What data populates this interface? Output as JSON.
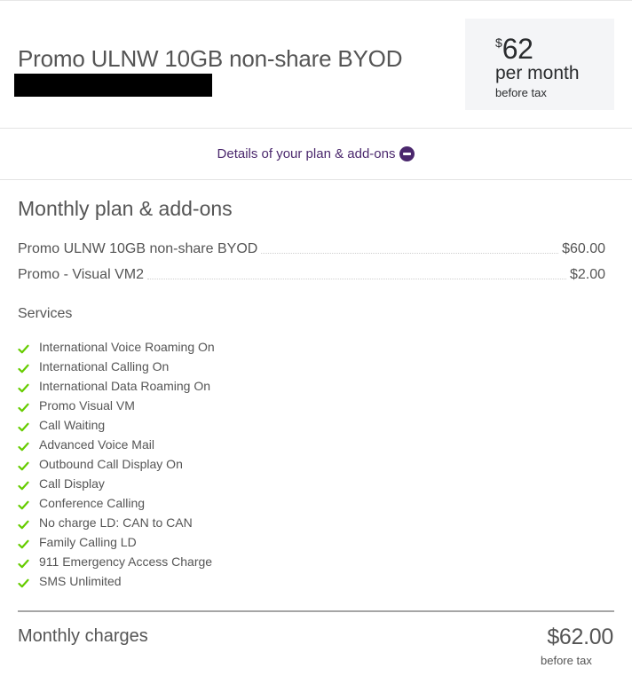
{
  "header": {
    "plan_title": "Promo ULNW 10GB non-share BYOD",
    "price": {
      "currency_symbol": "$",
      "amount": "62",
      "period": "per month",
      "note": "before tax"
    }
  },
  "details_toggle": {
    "label": "Details of your plan & add-ons",
    "icon": "minus-circle-icon",
    "expanded": true
  },
  "plan_section": {
    "title": "Monthly plan & add-ons",
    "items": [
      {
        "label": "Promo ULNW 10GB non-share BYOD",
        "price": "$60.00"
      },
      {
        "label": "Promo - Visual VM2",
        "price": "$2.00"
      }
    ]
  },
  "services": {
    "title": "Services",
    "icon": "check-icon",
    "check_color": "#66cc00",
    "items": [
      "International Voice Roaming On",
      "International Calling On",
      "International Data Roaming On",
      "Promo Visual VM",
      "Call Waiting",
      "Advanced Voice Mail",
      "Outbound Call Display On",
      "Call Display",
      "Conference Calling",
      "No charge LD: CAN to CAN",
      "Family Calling LD",
      "911 Emergency Access Charge",
      "SMS Unlimited"
    ]
  },
  "summary": {
    "label": "Monthly charges",
    "total": "$62.00",
    "note": "before tax"
  },
  "colors": {
    "brand_purple": "#4b286d",
    "check_green": "#66cc00",
    "price_box_bg": "#f4f5f7"
  }
}
